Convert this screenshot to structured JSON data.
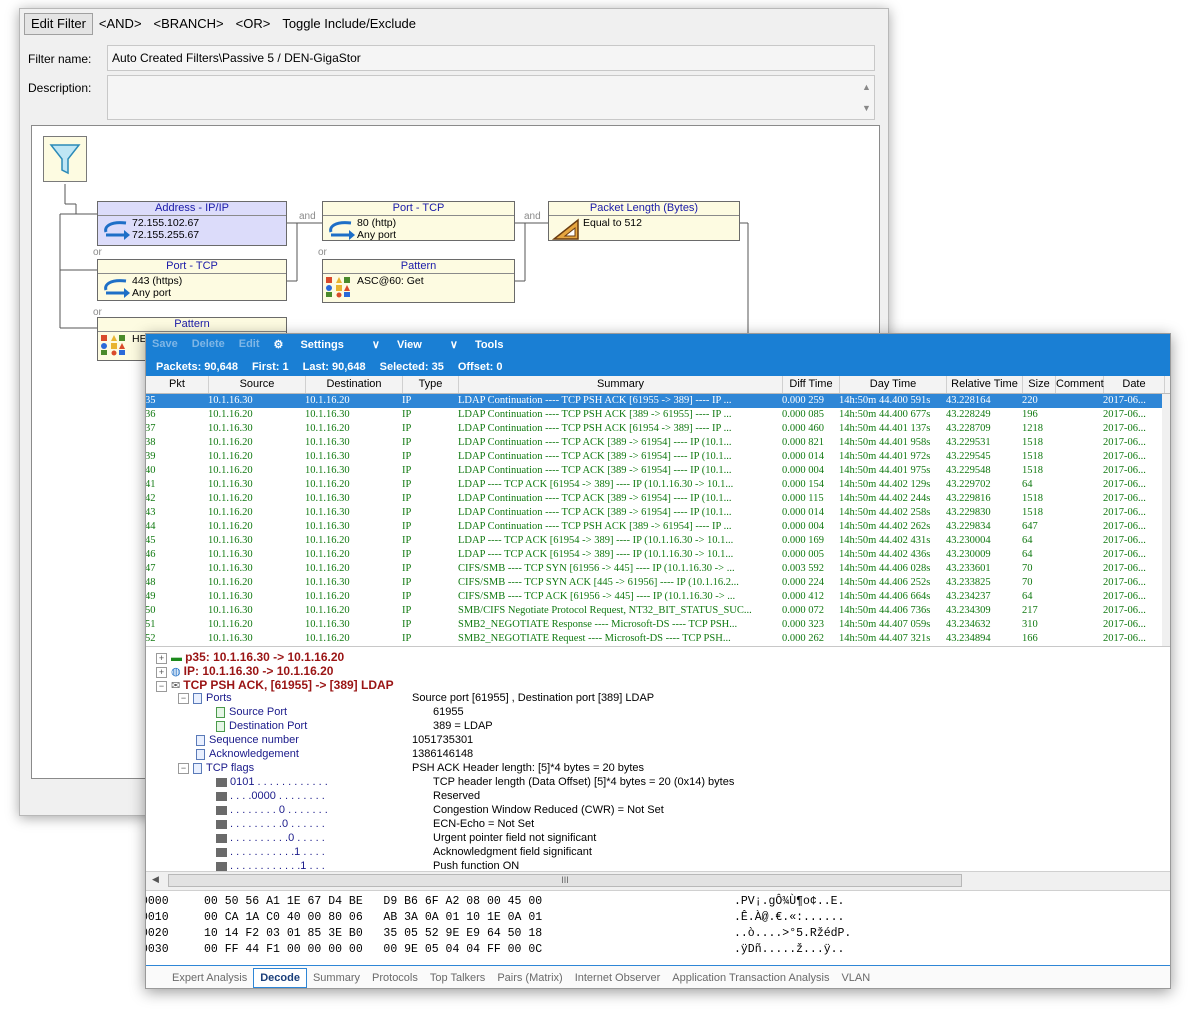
{
  "filter_editor": {
    "toolbar": [
      "Edit Filter",
      "<AND>",
      "<BRANCH>",
      "<OR>",
      "Toggle Include/Exclude"
    ],
    "filter_name_label": "Filter name:",
    "filter_name_value": "Auto Created Filters\\Passive 5 / DEN-GigaStor",
    "description_label": "Description:",
    "description_value": "",
    "nodes": {
      "address": {
        "title": "Address - IP/IP",
        "line1": "72.155.102.67",
        "line2": "72.155.255.67"
      },
      "port_tcp_1": {
        "title": "Port - TCP",
        "line1": "80  (http)",
        "line2": "Any port"
      },
      "packet_length": {
        "title": "Packet Length (Bytes)",
        "line1": "Equal to 512"
      },
      "port_tcp_2": {
        "title": "Port - TCP",
        "line1": "443  (https)",
        "line2": "Any port"
      },
      "pattern_1": {
        "title": "Pattern",
        "line1": "ASC@60: Get"
      },
      "pattern_2": {
        "title": "Pattern",
        "line1": "HE"
      }
    },
    "connectors": {
      "and1": "and",
      "and2": "and",
      "or1": "or",
      "or2": "or",
      "or3": "or"
    }
  },
  "decode": {
    "toolbar": {
      "save": "Save",
      "delete": "Delete",
      "edit": "Edit",
      "settings": "Settings",
      "view": "View",
      "tools": "Tools"
    },
    "stats": {
      "packets": "Packets: 90,648",
      "first": "First: 1",
      "last": "Last: 90,648",
      "selected": "Selected: 35",
      "offset": "Offset: 0"
    },
    "columns": [
      "Pkt",
      "Source",
      "Destination",
      "Type",
      "Summary",
      "Diff Time",
      "Day Time",
      "Relative Time",
      "Size",
      "Comment",
      "Date"
    ],
    "rows": [
      [
        "35",
        "10.1.16.30",
        "10.1.16.20",
        "IP",
        "LDAP Continuation  ----  TCP PSH ACK [61955 -> 389]  ----  IP ...",
        "0.000 259",
        "14h:50m 44.400 591s",
        "43.228164",
        "220",
        "",
        "2017-06..."
      ],
      [
        "36",
        "10.1.16.20",
        "10.1.16.30",
        "IP",
        "LDAP Continuation  ----  TCP PSH ACK [389 -> 61955]  ----  IP ...",
        "0.000 085",
        "14h:50m 44.400 677s",
        "43.228249",
        "196",
        "",
        "2017-06..."
      ],
      [
        "37",
        "10.1.16.30",
        "10.1.16.20",
        "IP",
        "LDAP Continuation  ----  TCP PSH ACK [61954 -> 389]  ----  IP ...",
        "0.000 460",
        "14h:50m 44.401 137s",
        "43.228709",
        "1218",
        "",
        "2017-06..."
      ],
      [
        "38",
        "10.1.16.20",
        "10.1.16.30",
        "IP",
        "LDAP Continuation  ----  TCP ACK [389 -> 61954]  ----  IP (10.1...",
        "0.000 821",
        "14h:50m 44.401 958s",
        "43.229531",
        "1518",
        "",
        "2017-06..."
      ],
      [
        "39",
        "10.1.16.20",
        "10.1.16.30",
        "IP",
        "LDAP Continuation  ----  TCP ACK [389 -> 61954]  ----  IP (10.1...",
        "0.000 014",
        "14h:50m 44.401 972s",
        "43.229545",
        "1518",
        "",
        "2017-06..."
      ],
      [
        "40",
        "10.1.16.20",
        "10.1.16.30",
        "IP",
        "LDAP Continuation  ----  TCP ACK [389 -> 61954]  ----  IP (10.1...",
        "0.000 004",
        "14h:50m 44.401 975s",
        "43.229548",
        "1518",
        "",
        "2017-06..."
      ],
      [
        "41",
        "10.1.16.30",
        "10.1.16.20",
        "IP",
        "LDAP  ----  TCP ACK [61954 -> 389]  ----  IP (10.1.16.30 -> 10.1...",
        "0.000 154",
        "14h:50m 44.402 129s",
        "43.229702",
        "64",
        "",
        "2017-06..."
      ],
      [
        "42",
        "10.1.16.20",
        "10.1.16.30",
        "IP",
        "LDAP Continuation  ----  TCP ACK [389 -> 61954]  ----  IP (10.1...",
        "0.000 115",
        "14h:50m 44.402 244s",
        "43.229816",
        "1518",
        "",
        "2017-06..."
      ],
      [
        "43",
        "10.1.16.20",
        "10.1.16.30",
        "IP",
        "LDAP Continuation  ----  TCP ACK [389 -> 61954]  ----  IP (10.1...",
        "0.000 014",
        "14h:50m 44.402 258s",
        "43.229830",
        "1518",
        "",
        "2017-06..."
      ],
      [
        "44",
        "10.1.16.20",
        "10.1.16.30",
        "IP",
        "LDAP Continuation  ----  TCP PSH ACK [389 -> 61954]  ----  IP ...",
        "0.000 004",
        "14h:50m 44.402 262s",
        "43.229834",
        "647",
        "",
        "2017-06..."
      ],
      [
        "45",
        "10.1.16.30",
        "10.1.16.20",
        "IP",
        "LDAP  ----  TCP ACK [61954 -> 389]  ----  IP (10.1.16.30 -> 10.1...",
        "0.000 169",
        "14h:50m 44.402 431s",
        "43.230004",
        "64",
        "",
        "2017-06..."
      ],
      [
        "46",
        "10.1.16.30",
        "10.1.16.20",
        "IP",
        "LDAP  ----  TCP ACK [61954 -> 389]  ----  IP (10.1.16.30 -> 10.1...",
        "0.000 005",
        "14h:50m 44.402 436s",
        "43.230009",
        "64",
        "",
        "2017-06..."
      ],
      [
        "47",
        "10.1.16.30",
        "10.1.16.20",
        "IP",
        "CIFS/SMB  ----  TCP SYN [61956 -> 445]  ----  IP (10.1.16.30 -> ...",
        "0.003 592",
        "14h:50m 44.406 028s",
        "43.233601",
        "70",
        "",
        "2017-06..."
      ],
      [
        "48",
        "10.1.16.20",
        "10.1.16.30",
        "IP",
        "CIFS/SMB  ----  TCP SYN ACK [445 -> 61956]  ----  IP (10.1.16.2...",
        "0.000 224",
        "14h:50m 44.406 252s",
        "43.233825",
        "70",
        "",
        "2017-06..."
      ],
      [
        "49",
        "10.1.16.30",
        "10.1.16.20",
        "IP",
        "CIFS/SMB  ----  TCP ACK [61956 -> 445]  ----  IP (10.1.16.30 -> ...",
        "0.000 412",
        "14h:50m 44.406 664s",
        "43.234237",
        "64",
        "",
        "2017-06..."
      ],
      [
        "50",
        "10.1.16.30",
        "10.1.16.20",
        "IP",
        "SMB/CIFS Negotiate Protocol Request, NT32_BIT_STATUS_SUC...",
        "0.000 072",
        "14h:50m 44.406 736s",
        "43.234309",
        "217",
        "",
        "2017-06..."
      ],
      [
        "51",
        "10.1.16.20",
        "10.1.16.30",
        "IP",
        "SMB2_NEGOTIATE Response  ----  Microsoft-DS  ----  TCP PSH...",
        "0.000 323",
        "14h:50m 44.407 059s",
        "43.234632",
        "310",
        "",
        "2017-06..."
      ],
      [
        "52",
        "10.1.16.30",
        "10.1.16.20",
        "IP",
        "SMB2_NEGOTIATE Request  ----  Microsoft-DS  ----  TCP PSH...",
        "0.000 262",
        "14h:50m 44.407 321s",
        "43.234894",
        "166",
        "",
        "2017-06..."
      ]
    ],
    "detail": {
      "p35": "p35:  10.1.16.30 -> 10.1.16.20",
      "ip": "IP:   10.1.16.30 -> 10.1.16.20",
      "tcp": "TCP  PSH ACK,   [61955]  -> [389] LDAP",
      "ports_label": "Ports",
      "ports_value": "Source port [61955] , Destination port [389] LDAP",
      "source_port_label": "Source Port",
      "source_port_value": "61955",
      "dest_port_label": "Destination Port",
      "dest_port_value": "389 = LDAP",
      "seq_label": "Sequence number",
      "seq_value": "1051735301",
      "ack_label": "Acknowledgement",
      "ack_value": "1386146148",
      "flags_label": "TCP flags",
      "flags_value": "PSH ACK   Header length: [5]*4 bytes = 20 bytes",
      "bits": [
        {
          "bits": "0101 . . . .   . . . . . . . .",
          "desc": "TCP header length (Data Offset) [5]*4 bytes = 20 (0x14) bytes"
        },
        {
          "bits": ". . . .0000   . . . . . . . .",
          "desc": "Reserved"
        },
        {
          "bits": ". . . . . . . .   0 . . . . . . .",
          "desc": "Congestion Window Reduced (CWR) = Not Set"
        },
        {
          "bits": ". . . . . . . .   .0 . . . . . .",
          "desc": "ECN-Echo = Not Set"
        },
        {
          "bits": ". . . . . . . .   . .0 . . . . .",
          "desc": "Urgent pointer field not significant"
        },
        {
          "bits": ". . . . . . . .   . . .1 . . . .",
          "desc": "Acknowledgment field significant"
        },
        {
          "bits": ". . . . . . . .   . . . .1 . . .",
          "desc": "Push function ON"
        }
      ]
    },
    "scroll_thumb": "III",
    "hex": [
      {
        "off": "0000",
        "bytes": "00 50 56 A1 1E 67 D4 BE   D9 B6 6F A2 08 00 45 00",
        "ascii": ".PV¡.gÔ¾Ù¶o¢..E."
      },
      {
        "off": "0010",
        "bytes": "00 CA 1A C0 40 00 80 06   AB 3A 0A 01 10 1E 0A 01",
        "ascii": ".Ê.À@.€.«:......"
      },
      {
        "off": "0020",
        "bytes": "10 14 F2 03 01 85 3E B0   35 05 52 9E E9 64 50 18",
        "ascii": "..ò....>°5.RžédP."
      },
      {
        "off": "0030",
        "bytes": "00 FF 44 F1 00 00 00 00   00 9E 05 04 04 FF 00 0C",
        "ascii": ".ÿDñ.....ž...ÿ.."
      }
    ],
    "tabs": [
      "Expert Analysis",
      "Decode",
      "Summary",
      "Protocols",
      "Top Talkers",
      "Pairs (Matrix)",
      "Internet Observer",
      "Application Transaction Analysis",
      "VLAN"
    ],
    "active_tab": "Decode"
  }
}
